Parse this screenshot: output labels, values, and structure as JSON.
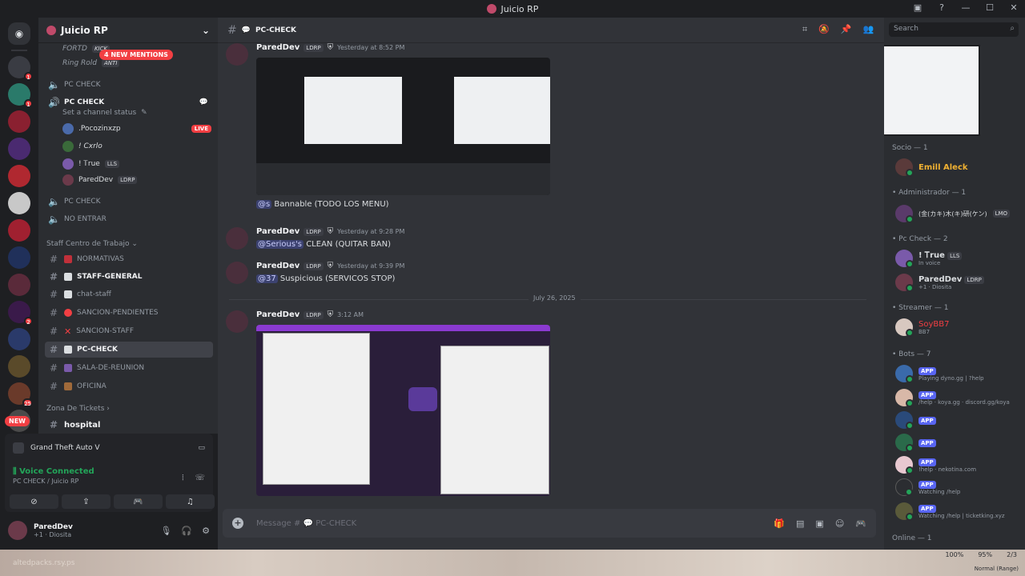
{
  "window": {
    "title": "Juicio RP"
  },
  "rail": {
    "new_label": "NEW",
    "badges": [
      "1",
      "1",
      "2",
      "25"
    ]
  },
  "sidebar": {
    "server_name": "Juicio RP",
    "mentions_pill": "4 NEW MENTIONS",
    "top_users": [
      "FORTD",
      "KICK",
      "Ring Rold",
      "ANTI"
    ],
    "channels": [
      {
        "name": "PC CHECK"
      },
      {
        "name": "PC CHECK"
      },
      {
        "name": "PC CHECK"
      },
      {
        "name": "NO ENTRAR"
      }
    ],
    "set_status": "Set a channel status",
    "voice_users": [
      {
        "name": ".Pocozinxzp",
        "live": "LIVE"
      },
      {
        "name": "! Cxrlo"
      },
      {
        "name": "! Ꭲrue",
        "tag": "LLS"
      },
      {
        "name": "ParedDev",
        "tag": "LDRP"
      }
    ],
    "category_staff": "Staff Centro de Trabajo",
    "staff_channels": [
      "NORMATIVAS",
      "STAFF-GENERAL",
      "chat-staff",
      "SANCION-PENDIENTES",
      "SANCION-STAFF",
      "PC-CHECK",
      "SALA-DE-REUNION",
      "OFICINA"
    ],
    "category_tickets": "Zona De Tickets",
    "ticket_channel": "hospital"
  },
  "activity": {
    "game": "Grand Theft Auto V"
  },
  "voice": {
    "status": "Voice Connected",
    "channel": "PC CHECK",
    "server": "Juicio RP"
  },
  "user": {
    "name": "ParedDev",
    "sub": "+1 · Diosita"
  },
  "chat": {
    "channel": "PC-CHECK",
    "messages": [
      {
        "author": "ParedDev",
        "tag": "LDRP",
        "time": "Yesterday at 8:52 PM",
        "mention": "@s",
        "text": "Bannable (TODO LOS MENU)"
      },
      {
        "author": "ParedDev",
        "tag": "LDRP",
        "time": "Yesterday at 9:28 PM",
        "mention": "@Serious's",
        "text": "CLEAN (QUITAR BAN)"
      },
      {
        "author": "ParedDev",
        "tag": "LDRP",
        "time": "Yesterday at 9:39 PM",
        "mention": "@37",
        "text": "Suspicious (SERVICOS STOP)"
      },
      {
        "author": "ParedDev",
        "tag": "LDRP",
        "time": "3:12 AM"
      }
    ],
    "date_divider": "July 26, 2025",
    "composer_placeholder": "Message #",
    "composer_channel": "PC-CHECK"
  },
  "members": {
    "search_placeholder": "Search",
    "groups": [
      {
        "label": "Socio — 1",
        "members": [
          {
            "name": "Emill Aleck",
            "color": "#f0b132"
          }
        ]
      },
      {
        "label": "• Administrador — 1",
        "members": [
          {
            "name": "(金(カキ)木(キ)研(ケン)",
            "tag": "LMO"
          }
        ]
      },
      {
        "label": "• Pc Check — 2",
        "members": [
          {
            "name": "! Ꭲrue",
            "tag": "LLS",
            "sub": "In voice"
          },
          {
            "name": "ParedDev",
            "tag": "LDRP",
            "sub": "+1 · Diosita"
          }
        ]
      },
      {
        "label": "• Streamer — 1",
        "members": [
          {
            "name": "SoyBB7",
            "sub": "BB7",
            "color": "#f23f43"
          }
        ]
      },
      {
        "label": "• Bots — 7",
        "members": [
          {
            "name": "",
            "tag": "APP",
            "sub": "Playing dyno.gg | ?help"
          },
          {
            "name": "",
            "tag": "APP",
            "sub": "/help · koya.gg · discord.gg/koya"
          },
          {
            "name": "",
            "tag": "APP",
            "sub": ""
          },
          {
            "name": "",
            "tag": "APP",
            "sub": ""
          },
          {
            "name": "",
            "tag": "APP",
            "sub": "!help · nekotina.com"
          },
          {
            "name": "",
            "tag": "APP",
            "sub": "Watching /help"
          },
          {
            "name": "",
            "tag": "APP",
            "sub": "Watching /help | ticketking.xyz"
          }
        ]
      },
      {
        "label": "Online — 1",
        "members": []
      }
    ]
  },
  "overlay": {
    "watermark": "altedpacks.rsy.ps",
    "zoom": "100%",
    "zoom2": "95%",
    "page": "2/3",
    "mode": "Normal (Range)"
  }
}
